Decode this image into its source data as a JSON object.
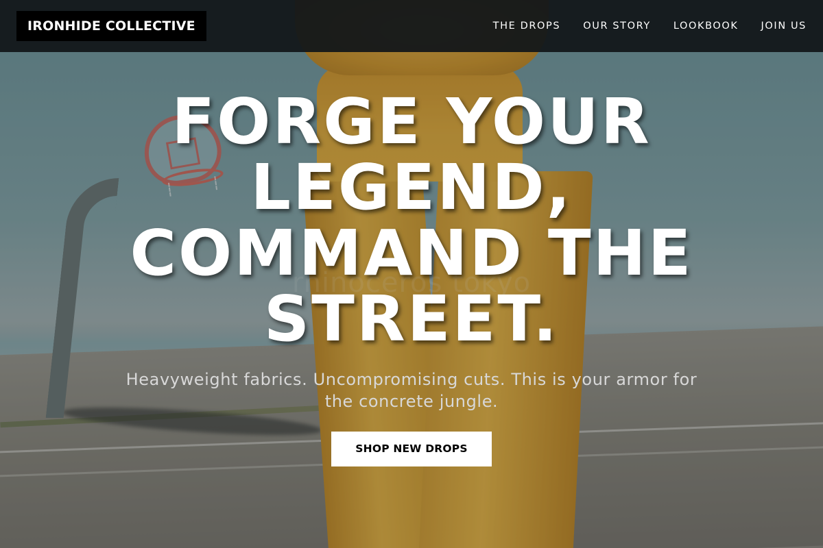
{
  "brand": {
    "name": "IRONHIDE COLLECTIVE"
  },
  "nav": {
    "items": [
      {
        "label": "THE DROPS"
      },
      {
        "label": "OUR STORY"
      },
      {
        "label": "LOOKBOOK"
      },
      {
        "label": "JOIN US"
      }
    ]
  },
  "hero": {
    "headline_lines": [
      "FORGE YOUR",
      "LEGEND,",
      "COMMAND THE",
      "STREET."
    ],
    "subheadline": "Heavyweight fabrics. Uncompromising cuts. This is your armor for the concrete jungle.",
    "cta_label": "SHOP NEW DROPS",
    "background_watermark": "rhinoceros tokyo"
  },
  "colors": {
    "nav_background": "#12161a",
    "logo_background": "#000000",
    "headline_text": "#ffffff",
    "subheadline_text": "#d8d8d8",
    "cta_background": "#ffffff",
    "cta_text": "#000000"
  }
}
